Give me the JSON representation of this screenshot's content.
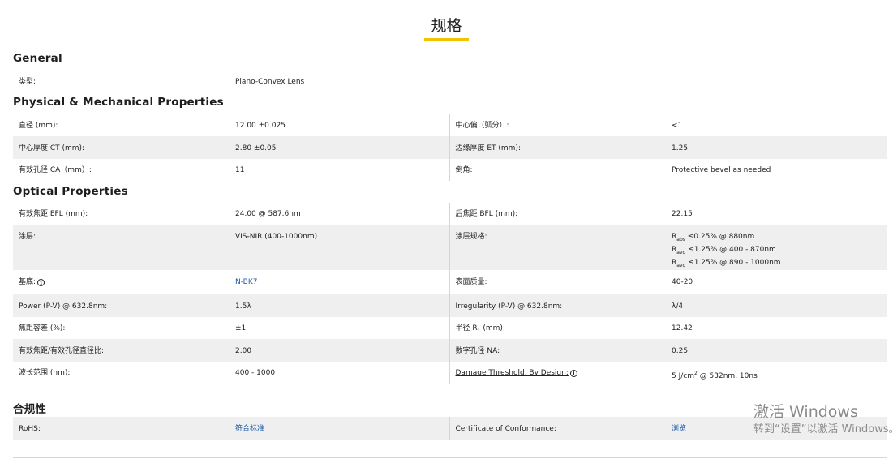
{
  "page_title": "规格",
  "sections": {
    "general": "General",
    "physical": "Physical & Mechanical Properties",
    "optical": "Optical Properties",
    "compliance": "合规性"
  },
  "general": {
    "type_label": "类型:",
    "type_value": "Plano-Convex Lens"
  },
  "physical": {
    "diameter_label": "直径 (mm):",
    "diameter_value": "12.00 ±0.025",
    "centering_label": "中心偏（弧分）:",
    "centering_value": "<1",
    "ct_label": "中心厚度 CT (mm):",
    "ct_value": "2.80 ±0.05",
    "et_label": "边缘厚度 ET (mm):",
    "et_value": "1.25",
    "ca_label": "有效孔径 CA（mm）:",
    "ca_value": "11",
    "bevel_label": "倒角:",
    "bevel_value": "Protective bevel as needed"
  },
  "optical": {
    "efl_label": "有效焦距 EFL (mm):",
    "efl_value": "24.00 @ 587.6nm",
    "bfl_label": "后焦距 BFL (mm):",
    "bfl_value": "22.15",
    "coating_label": "涂层:",
    "coating_value": "VIS-NIR (400-1000nm)",
    "coating_spec_label": "涂层规格:",
    "coating_spec_lines": [
      {
        "prefix": "R",
        "sub": "abs",
        "text": " ≤0.25% @ 880nm"
      },
      {
        "prefix": "R",
        "sub": "avg",
        "text": " ≤1.25% @ 400 - 870nm"
      },
      {
        "prefix": "R",
        "sub": "avg",
        "text": " ≤1.25% @ 890 - 1000nm"
      }
    ],
    "substrate_label": "基底:",
    "substrate_value": "N-BK7",
    "surface_quality_label": "表面质量:",
    "surface_quality_value": "40-20",
    "power_label": "Power (P-V) @ 632.8nm:",
    "power_value": "1.5λ",
    "irregularity_label": "Irregularity (P-V) @ 632.8nm:",
    "irregularity_value": "λ/4",
    "focal_tol_label": "焦距容差 (%):",
    "focal_tol_value": "±1",
    "radius_label_pre": "半径 R",
    "radius_label_sub": "1",
    "radius_label_post": " (mm):",
    "radius_value": "12.42",
    "fnum_label": "有效焦距/有效孔径直径比:",
    "fnum_value": "2.00",
    "na_label": "数字孔径 NA:",
    "na_value": "0.25",
    "wavelength_label": "波长范围 (nm):",
    "wavelength_value": "400 - 1000",
    "damage_label": "Damage Threshold, By Design:",
    "damage_value_pre": "5 J/cm",
    "damage_value_sup": "2",
    "damage_value_post": " @ 532nm, 10ns"
  },
  "compliance": {
    "rohs_label": "RoHS:",
    "rohs_value": "符合标准",
    "coc_label": "Certificate of Conformance:",
    "coc_value": "浏览"
  },
  "info_icon_glyph": "i",
  "watermark": {
    "line1": "激活 Windows",
    "line2": "转到“设置”以激活 Windows。"
  }
}
